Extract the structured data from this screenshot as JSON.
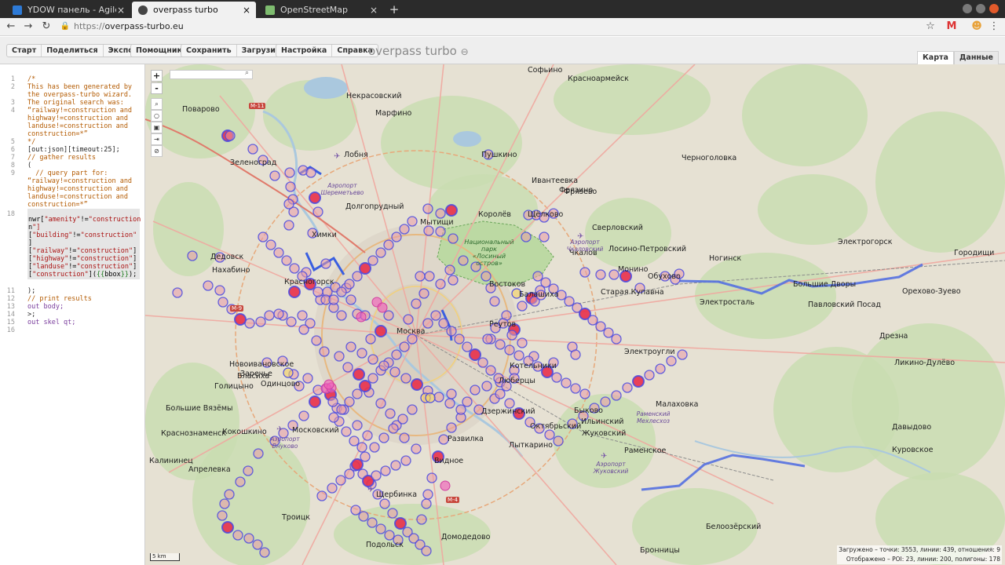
{
  "browser": {
    "tabs": [
      {
        "title": "YDOW панель - Agile-до",
        "active": false,
        "icon_color": "#2d7ad6"
      },
      {
        "title": "overpass turbo",
        "active": true,
        "icon_color": "#444444"
      },
      {
        "title": "OpenStreetMap",
        "active": false,
        "icon_color": "#7ebc6f"
      }
    ],
    "new_tab": "+",
    "url_scheme": "https://",
    "url_host": "overpass-turbo.eu"
  },
  "toolbar": {
    "group1": [
      "Старт",
      "Поделиться",
      "Экспорт"
    ],
    "group2": [
      "Помощник"
    ],
    "group3": [
      "Сохранить",
      "Загрузить"
    ],
    "group4": [
      "Настройка",
      "Справка"
    ],
    "brand": "overpass turbo",
    "view_tabs": [
      "Карта",
      "Данные"
    ]
  },
  "editor": {
    "line_numbers": [
      "1",
      "2",
      "3",
      "4",
      "",
      "",
      "",
      "5",
      "6",
      "7",
      "8",
      "9",
      "",
      "",
      "",
      "18",
      "",
      "",
      "",
      "",
      "",
      "",
      "",
      "",
      "11",
      "12",
      "13",
      "14",
      "15",
      "16"
    ],
    "lines": [
      {
        "n": "1",
        "text": "/*",
        "cls": "c-comment"
      },
      {
        "n": "2",
        "text": "This has been generated by",
        "cls": "c-comment"
      },
      {
        "n": "",
        "text": "the overpass-turbo wizard.",
        "cls": "c-comment"
      },
      {
        "n": "3",
        "text": "The original search was:",
        "cls": "c-comment"
      },
      {
        "n": "4",
        "text": "“railway!=construction and",
        "cls": "c-comment"
      },
      {
        "n": "",
        "text": "highway!=construction and",
        "cls": "c-comment"
      },
      {
        "n": "",
        "text": "landuse!=construction and",
        "cls": "c-comment"
      },
      {
        "n": "",
        "text": "construction=*”",
        "cls": "c-comment"
      },
      {
        "n": "5",
        "text": "*/",
        "cls": "c-comment"
      },
      {
        "n": "6",
        "text": "[out:json][timeout:25];",
        "cls": "c-plain"
      },
      {
        "n": "7",
        "text": "// gather results",
        "cls": "c-comment"
      },
      {
        "n": "8",
        "text": "(",
        "cls": "c-plain"
      },
      {
        "n": "9",
        "text": "  // query part for:",
        "cls": "c-comment"
      },
      {
        "n": "",
        "text": "“railway!=construction and",
        "cls": "c-comment"
      },
      {
        "n": "",
        "text": "highway!=construction and",
        "cls": "c-comment"
      },
      {
        "n": "",
        "text": "landuse!=construction and",
        "cls": "c-comment"
      },
      {
        "n": "",
        "text": "construction=*”",
        "cls": "c-comment"
      }
    ],
    "highlight_line_no": "18",
    "highlight_lines": [
      "nwr[\"amenity\"!=\"construction",
      "n\"]",
      "[\"building\"!=\"construction\"",
      "]",
      "[\"railway\"!=\"construction\"]",
      "[\"highway\"!=\"construction\"]",
      "[\"landuse\"!=\"construction\"]",
      "[\"construction\"]({{bbox}});"
    ],
    "tail_lines": [
      {
        "n": "11",
        "text": ");",
        "cls": "c-plain"
      },
      {
        "n": "12",
        "text": "// print results",
        "cls": "c-comment"
      },
      {
        "n": "13",
        "text": "out body;",
        "cls": "c-key"
      },
      {
        "n": "14",
        "text": ">;",
        "cls": "c-plain"
      },
      {
        "n": "15",
        "text": "out skel qt;",
        "cls": "c-key"
      },
      {
        "n": "16",
        "text": "",
        "cls": "c-plain"
      }
    ]
  },
  "map": {
    "zoom_in": "+",
    "zoom_out": "-",
    "scale": "5 km",
    "stats_loaded": "Загружено – точки: 3553, линии: 439, отношения: 9",
    "stats_shown": "Отображено – POI: 23, линии: 200, полигоны: 178",
    "labels": [
      {
        "t": "Зеленоград",
        "c": "city"
      },
      {
        "t": "Химки",
        "c": "city"
      },
      {
        "t": "Долгопрудный",
        "c": "city"
      },
      {
        "t": "Мытищи",
        "c": "city"
      },
      {
        "t": "Королёв",
        "c": "city"
      },
      {
        "t": "Щёлково",
        "c": "city"
      },
      {
        "t": "Пушкино",
        "c": "city"
      },
      {
        "t": "Красногорск",
        "c": "city"
      },
      {
        "t": "Москва",
        "c": "city"
      },
      {
        "t": "Балашиха",
        "c": "city"
      },
      {
        "t": "Реутов",
        "c": "city"
      },
      {
        "t": "Люберцы",
        "c": "city"
      },
      {
        "t": "Одинцово",
        "c": "city"
      },
      {
        "t": "Краснознаменск",
        "c": "city"
      },
      {
        "t": "Жуковский",
        "c": "city"
      },
      {
        "t": "Раменское",
        "c": "city"
      },
      {
        "t": "Ногинск",
        "c": "city"
      },
      {
        "t": "Электросталь",
        "c": "city"
      },
      {
        "t": "Орехово-Зуево",
        "c": "city"
      },
      {
        "t": "Домодедово",
        "c": "city"
      },
      {
        "t": "Подольск",
        "c": "city"
      },
      {
        "t": "Видное",
        "c": "city"
      },
      {
        "t": "Щербинка",
        "c": "city"
      },
      {
        "t": "Дзержинский",
        "c": "city"
      },
      {
        "t": "Котельники",
        "c": "city"
      },
      {
        "t": "Лыткарино",
        "c": "city"
      },
      {
        "t": "Троицк",
        "c": "city"
      },
      {
        "t": "Московский",
        "c": "city"
      },
      {
        "t": "Фрязино",
        "c": "city"
      },
      {
        "t": "Ивантеевка",
        "c": "city"
      },
      {
        "t": "Лобня",
        "c": "city"
      },
      {
        "t": "Софьино",
        "c": "city"
      },
      {
        "t": "Красноармейск",
        "c": "city"
      },
      {
        "t": "Некрасовский",
        "c": "city"
      },
      {
        "t": "Марфино",
        "c": "city"
      },
      {
        "t": "Поварово",
        "c": "city"
      },
      {
        "t": "Сверловский",
        "c": "city"
      },
      {
        "t": "Лосино-Петровский",
        "c": "city"
      },
      {
        "t": "Монино",
        "c": "city"
      },
      {
        "t": "Электрогорск",
        "c": "city"
      },
      {
        "t": "Городищи",
        "c": "city"
      },
      {
        "t": "Павловский Посад",
        "c": "city"
      },
      {
        "t": "Старая Купавна",
        "c": "city"
      },
      {
        "t": "Электроугли",
        "c": "city"
      },
      {
        "t": "Обухово",
        "c": "city"
      },
      {
        "t": "Дрезна",
        "c": "city"
      },
      {
        "t": "Ликино-Дулёво",
        "c": "city"
      },
      {
        "t": "Давыдово",
        "c": "city"
      },
      {
        "t": "Куровское",
        "c": "city"
      },
      {
        "t": "Бронницы",
        "c": "city"
      },
      {
        "t": "Белоозёрский",
        "c": "city"
      },
      {
        "t": "Малаховка",
        "c": "city"
      },
      {
        "t": "Октябрьский",
        "c": "city"
      },
      {
        "t": "Ильинский",
        "c": "city"
      },
      {
        "t": "Быково",
        "c": "city"
      },
      {
        "t": "Развилка",
        "c": "city"
      },
      {
        "t": "Голицыно",
        "c": "city"
      },
      {
        "t": "Кокошкино",
        "c": "city"
      },
      {
        "t": "Калининец",
        "c": "city"
      },
      {
        "t": "Апрелевка",
        "c": "city"
      },
      {
        "t": "Власиха",
        "c": "city"
      },
      {
        "t": "Заречье",
        "c": "city"
      },
      {
        "t": "Новоивановское",
        "c": "city"
      },
      {
        "t": "Нахабино",
        "c": "city"
      },
      {
        "t": "Дедовск",
        "c": "city"
      },
      {
        "t": "Черноголовка",
        "c": "city"
      },
      {
        "t": "Фрязево",
        "c": "city"
      },
      {
        "t": "Большие Дворы",
        "c": "city"
      },
      {
        "t": "Чкалов",
        "c": "city"
      },
      {
        "t": "Востоков",
        "c": "city"
      },
      {
        "t": "Большие Вязёмы",
        "c": "city"
      },
      {
        "t": "М-11",
        "c": "road"
      },
      {
        "t": "М-9",
        "c": "road"
      },
      {
        "t": "М-4",
        "c": "road"
      },
      {
        "t": "Национальный парк «Лосиный остров»",
        "c": "park"
      },
      {
        "t": "Аэропорт Шереметьево",
        "c": "airport"
      },
      {
        "t": "Аэропорт Внуково",
        "c": "airport"
      },
      {
        "t": "Аэропорт Чкаловский",
        "c": "airport"
      },
      {
        "t": "Аэропорт Жуковский",
        "c": "airport"
      },
      {
        "t": "Раменский Мехлесхоз",
        "c": "airport"
      }
    ]
  }
}
